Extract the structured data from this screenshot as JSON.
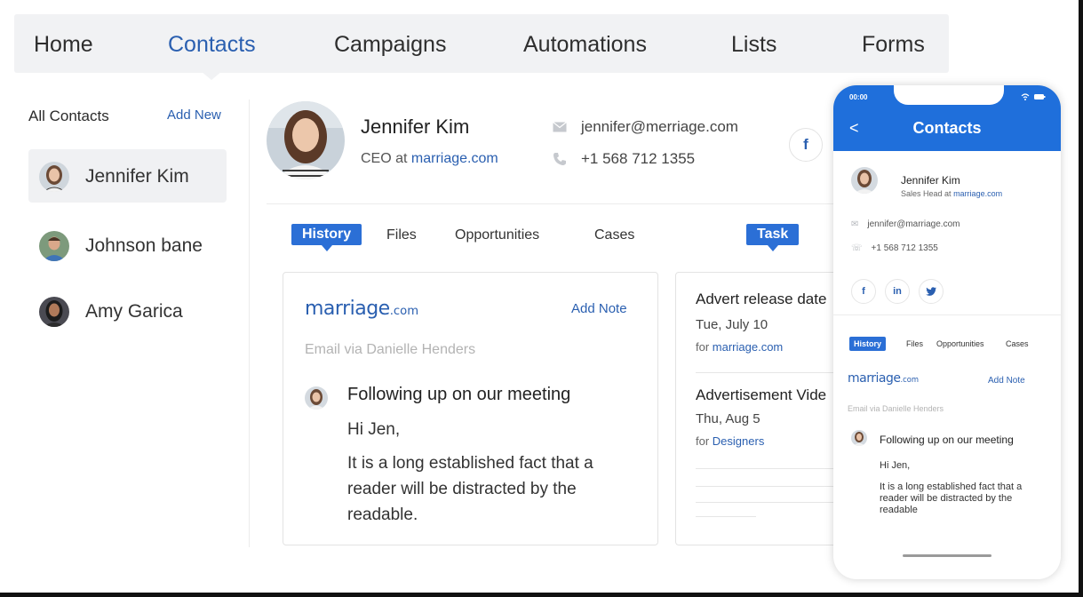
{
  "nav": {
    "items": [
      "Home",
      "Contacts",
      "Campaigns",
      "Automations",
      "Lists",
      "Forms"
    ],
    "active": "Contacts"
  },
  "sidebar": {
    "title": "All Contacts",
    "add_label": "Add New",
    "contacts": [
      {
        "name": "Jennifer Kim",
        "selected": true
      },
      {
        "name": "Johnson bane",
        "selected": false
      },
      {
        "name": "Amy Garica",
        "selected": false
      }
    ]
  },
  "profile": {
    "name": "Jennifer Kim",
    "role_prefix": "CEO at",
    "company": "marriage.com",
    "email": "jennifer@merriage.com",
    "phone": "+1 568 712 1355",
    "social": [
      "f"
    ]
  },
  "tabs": {
    "items": [
      "History",
      "Files",
      "Opportunities",
      "Cases"
    ],
    "active": "History",
    "task_label": "Task"
  },
  "history_card": {
    "logo_main": "marriage",
    "logo_suffix": ".com",
    "add_note": "Add Note",
    "via": "Email via Danielle Henders",
    "subject": "Following up on our meeting",
    "greeting": "Hi Jen,",
    "body": "It is a long established fact that a reader will be distracted by the readable."
  },
  "tasks": [
    {
      "title": "Advert release date",
      "date": "Tue, July 10",
      "for_prefix": "for",
      "for_link": "marriage.com"
    },
    {
      "title": "Advertisement Vide",
      "date": "Thu, Aug 5",
      "for_prefix": "for",
      "for_link": "Designers"
    }
  ],
  "phone": {
    "time": "00:00",
    "status_icons": "wifi battery",
    "back": "<",
    "title": "Contacts",
    "name": "Jennifer Kim",
    "role_prefix": "Sales Head at",
    "company": "marriage.com",
    "email": "jennifer@marriage.com",
    "phone": "+1 568 712 1355",
    "social": [
      "f",
      "in",
      "twitter"
    ],
    "tabs": [
      "History",
      "Files",
      "Opportunities",
      "Cases"
    ],
    "add_note": "Add Note",
    "via": "Email via Danielle Henders",
    "subject": "Following up on our meeting",
    "greeting": "Hi Jen,",
    "body": "It is a long established fact that a reader will be distracted by the readable"
  },
  "colors": {
    "accent": "#2a5fb0",
    "tab_active": "#2b6fd6",
    "phone_header": "#1f6fdb",
    "nav_bg": "#f1f2f4"
  }
}
